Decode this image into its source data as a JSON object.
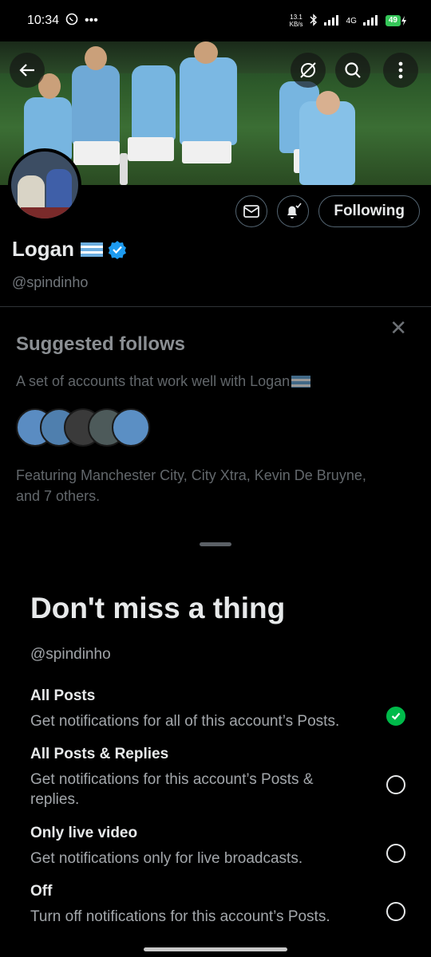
{
  "status_bar": {
    "time": "10:34",
    "dots": "•••",
    "net_speed_top": "13.1",
    "net_speed_bottom": "KB/s",
    "network": "4G",
    "battery": "49"
  },
  "profile": {
    "name": "Logan",
    "handle": "@spindinho",
    "following_label": "Following",
    "verified_color": "#1d9bf0"
  },
  "suggested": {
    "title": "Suggested follows",
    "subtitle": "A set of accounts that work well with Logan",
    "featuring": "Featuring Manchester City, City Xtra, Kevin De Bruyne, and 7 others."
  },
  "sheet": {
    "title": "Don't miss a thing",
    "handle": "@spindinho",
    "options": [
      {
        "title": "All Posts",
        "desc": "Get notifications for all of this account’s Posts.",
        "selected": true
      },
      {
        "title": "All Posts & Replies",
        "desc": "Get notifications for this account’s Posts & replies.",
        "selected": false
      },
      {
        "title": "Only live video",
        "desc": "Get notifications only for live broadcasts.",
        "selected": false
      },
      {
        "title": "Off",
        "desc": "Turn off notifications for this account’s Posts.",
        "selected": false
      }
    ]
  },
  "colors": {
    "accent": "#1d9bf0",
    "check": "#00ba4a"
  }
}
